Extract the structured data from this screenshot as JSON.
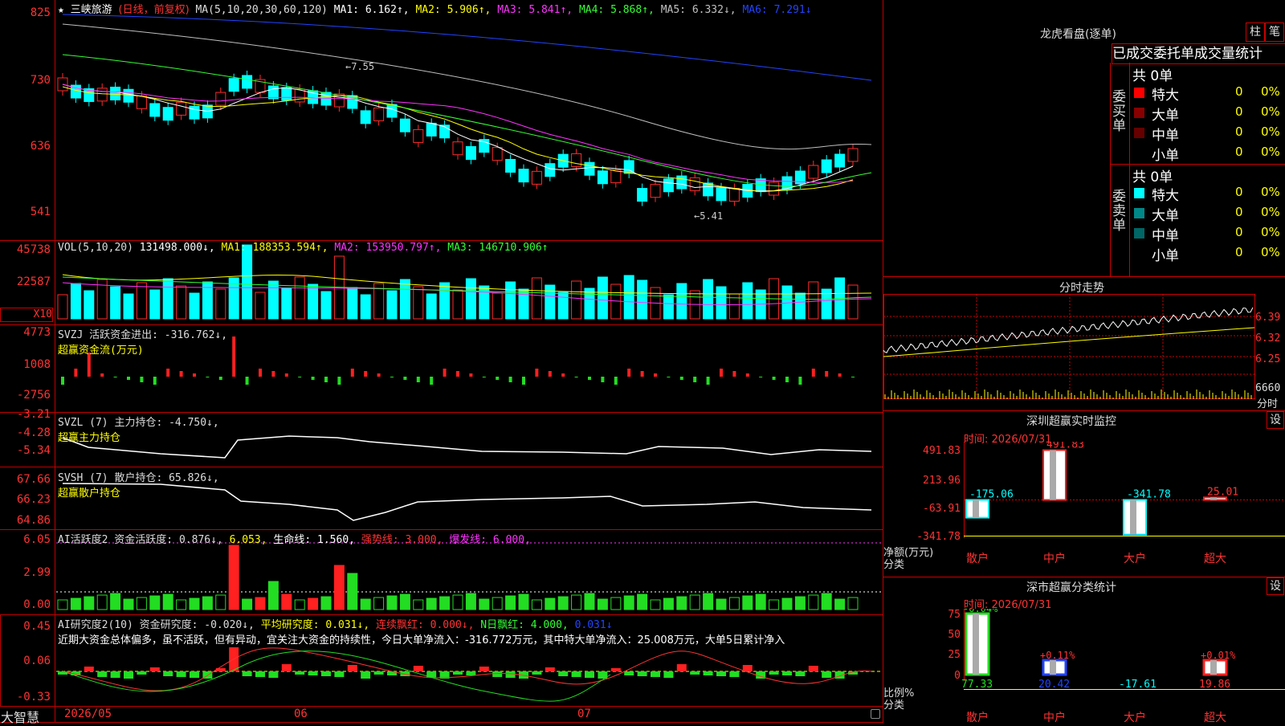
{
  "colors": {
    "up": "#ff2a2a",
    "down": "#00ffff",
    "grid": "#c00000",
    "ma1": "#ffffff",
    "ma2": "#ffff00",
    "ma3": "#ff33ff",
    "ma4": "#33ff33",
    "ma5": "#c0c0c0",
    "ma6": "#2244ff"
  },
  "main": {
    "star": "★",
    "stock_name": "三峡旅游",
    "mode": "(日线，前复权)",
    "ma_params": "MA(5,10,20,30,60,120)",
    "ma_legend": [
      {
        "text": "MA1: 6.162↑,",
        "color": "#ffffff"
      },
      {
        "text": "MA2: 5.906↑,",
        "color": "#ffff00"
      },
      {
        "text": "MA3: 5.841↑,",
        "color": "#ff33ff"
      },
      {
        "text": "MA4: 5.868↑,",
        "color": "#33ff33"
      },
      {
        "text": "MA5: 6.332↓,",
        "color": "#c0c0c0"
      },
      {
        "text": "MA6: 7.291↓",
        "color": "#2244ff"
      }
    ],
    "y_ticks": [
      "825",
      "730",
      "636",
      "541"
    ],
    "high_mark": "←7.55",
    "low_mark": "←5.41"
  },
  "vol": {
    "legend": [
      {
        "text": "VOL(5,10,20)",
        "color": "#dddddd"
      },
      {
        "text": "131498.000↓,",
        "color": "#ffffff"
      },
      {
        "text": "MA1: 188353.594↑,",
        "color": "#ffff00"
      },
      {
        "text": "MA2: 153950.797↑,",
        "color": "#ff33ff"
      },
      {
        "text": "MA3: 146710.906↑",
        "color": "#33ff33"
      }
    ],
    "y_ticks": [
      "45738",
      "22587"
    ],
    "unit": "X10"
  },
  "svzj": {
    "line1": "SVZJ  活跃资金进出: -316.762↓,",
    "line2": "超赢资金流(万元)",
    "y_ticks": [
      "4773",
      "1008",
      "-2756"
    ]
  },
  "svzl": {
    "line1": "SVZL (7) 主力持仓: -4.750↓,",
    "line2": "超赢主力持仓",
    "y_ticks": [
      "-3.21",
      "-4.28",
      "-5.34"
    ]
  },
  "svsh": {
    "line1": "SVSH (7) 散户持仓: 65.826↓,",
    "line2": "超赢散户持仓",
    "y_ticks": [
      "67.66",
      "66.23",
      "64.86"
    ]
  },
  "ai1": {
    "legend": [
      {
        "text": "AI活跃度2 资金活跃度: 0.876↓,",
        "color": "#dddddd"
      },
      {
        "text": "6.053,",
        "color": "#ffff00"
      },
      {
        "text": "生命线: 1.560,",
        "color": "#ffffff"
      },
      {
        "text": "强势线: 3.000,",
        "color": "#ff3333"
      },
      {
        "text": "爆发线: 6.000,",
        "color": "#ff33ff"
      }
    ],
    "y_ticks": [
      "6.05",
      "2.99",
      "0.00"
    ]
  },
  "ai2": {
    "legend": [
      {
        "text": "AI研究度2(10) 资金研究度: -0.020↓,",
        "color": "#dddddd"
      },
      {
        "text": "平均研究度: 0.031↓,",
        "color": "#ffff00"
      },
      {
        "text": "连续飘红: 0.000↓,",
        "color": "#ff3333"
      },
      {
        "text": "N日飘红: 4.000,",
        "color": "#33ff33"
      },
      {
        "text": "0.031↓",
        "color": "#2244ff"
      }
    ],
    "comment": "近期大资金总体偏多，虽不活跃，但有异动，宜关注大资金的持续性，今日大单净流入：-316.772万元，其中特大单净流入：25.008万元，大单5日累计净入",
    "y_ticks": [
      "0.45",
      "0.06",
      "-0.33"
    ]
  },
  "bottom": {
    "brand": "大智慧",
    "dates": [
      "2026/05",
      "06",
      "07"
    ]
  },
  "right": {
    "lh_title": "龙虎看盘(逐单)",
    "btn_zhu": "柱",
    "btn_bi": "笔",
    "tab_title": "已成交委托单成交量统计",
    "buy_group": "委买单",
    "sell_group": "委卖单",
    "buy_total": "共 0单",
    "sell_total": "共 0单",
    "buy_rows": [
      {
        "label": "特大",
        "count": "0",
        "pct": "0%",
        "color": "#ff0000"
      },
      {
        "label": "大单",
        "count": "0",
        "pct": "0%",
        "color": "#880000"
      },
      {
        "label": "中单",
        "count": "0",
        "pct": "0%",
        "color": "#660000"
      },
      {
        "label": "小单",
        "count": "0",
        "pct": "0%",
        "color": "#000000"
      }
    ],
    "sell_rows": [
      {
        "label": "特大",
        "count": "0",
        "pct": "0%",
        "color": "#00ffff"
      },
      {
        "label": "大单",
        "count": "0",
        "pct": "0%",
        "color": "#008888"
      },
      {
        "label": "中单",
        "count": "0",
        "pct": "0%",
        "color": "#006666"
      },
      {
        "label": "小单",
        "count": "0",
        "pct": "0%",
        "color": "#000000"
      }
    ],
    "intraday_title": "分时走势",
    "intraday_ticks": [
      "6.39",
      "6.32",
      "6.25",
      "6660"
    ],
    "intraday_unit": "分时",
    "monitor_title": "深圳超赢实时监控",
    "monitor_time": "时间: 2026/07/31",
    "monitor_ticks": [
      "491.83",
      "213.96",
      "-63.91",
      "-341.78"
    ],
    "monitor_axis": [
      "净额(万元)",
      "分类"
    ],
    "monitor_cats": [
      "散户",
      "中户",
      "大户",
      "超大"
    ],
    "monitor_values": [
      -175.06,
      491.83,
      -341.78,
      25.01
    ],
    "monitor_value_labels": [
      "-175.06",
      "491.83",
      "-341.78",
      "25.01"
    ],
    "stat_title": "深市超赢分类统计",
    "stat_time": "时间: 2026/07/31",
    "stat_ticks": [
      "75",
      "50",
      "25",
      "0"
    ],
    "stat_axis": [
      "比例%",
      "分类"
    ],
    "stat_cats": [
      "散户",
      "中户",
      "大户",
      "超大"
    ],
    "stat_values": [
      77.33,
      20.42,
      -17.61,
      19.86
    ],
    "stat_value_labels": [
      "77.33",
      "20.42",
      "-17.61",
      "19.86"
    ],
    "stat_changes": [
      "-0.04%",
      "+0.11%",
      "",
      "+0.01%"
    ],
    "btn_set": "设"
  }
}
